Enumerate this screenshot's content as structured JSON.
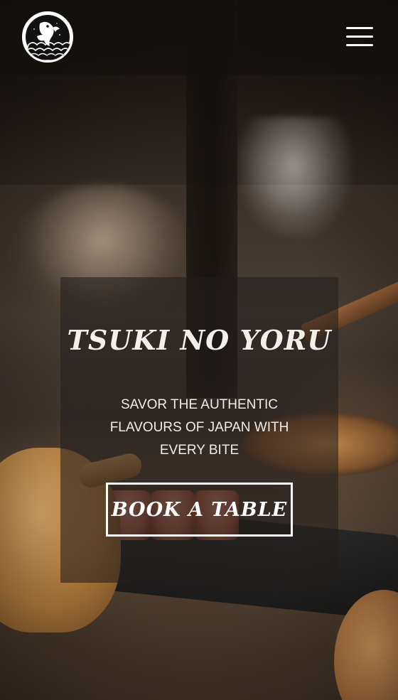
{
  "header": {
    "logo_name": "koi-fish-wave-logo",
    "menu_icon": "hamburger-menu-icon"
  },
  "hero": {
    "title": "TSUKI NO YORU",
    "tagline": "SAVOR THE AUTHENTIC FLAVOURS OF JAPAN WITH EVERY BITE",
    "cta_label": "BOOK A TABLE"
  },
  "colors": {
    "text": "#ffffff",
    "panel": "#231e1b",
    "header_bar": "#14100d"
  }
}
